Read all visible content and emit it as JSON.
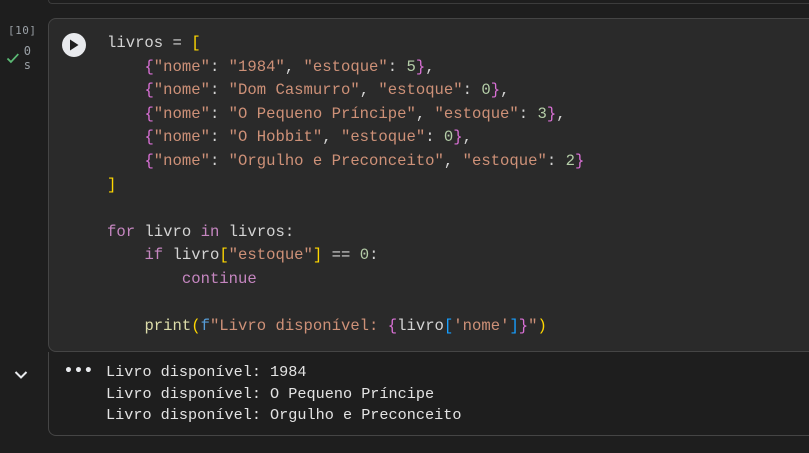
{
  "cell": {
    "execution_count": "[10]",
    "exec_time": "0 s",
    "code_lines": [
      [
        {
          "t": "livros = ",
          "c": ""
        },
        {
          "t": "[",
          "c": "br1"
        }
      ],
      [
        {
          "t": "    ",
          "c": ""
        },
        {
          "t": "{",
          "c": "br2"
        },
        {
          "t": "\"nome\"",
          "c": "str"
        },
        {
          "t": ": ",
          "c": ""
        },
        {
          "t": "\"1984\"",
          "c": "str"
        },
        {
          "t": ", ",
          "c": ""
        },
        {
          "t": "\"estoque\"",
          "c": "str"
        },
        {
          "t": ": ",
          "c": ""
        },
        {
          "t": "5",
          "c": "num"
        },
        {
          "t": "}",
          "c": "br2"
        },
        {
          "t": ",",
          "c": ""
        }
      ],
      [
        {
          "t": "    ",
          "c": ""
        },
        {
          "t": "{",
          "c": "br2"
        },
        {
          "t": "\"nome\"",
          "c": "str"
        },
        {
          "t": ": ",
          "c": ""
        },
        {
          "t": "\"Dom Casmurro\"",
          "c": "str"
        },
        {
          "t": ", ",
          "c": ""
        },
        {
          "t": "\"estoque\"",
          "c": "str"
        },
        {
          "t": ": ",
          "c": ""
        },
        {
          "t": "0",
          "c": "num"
        },
        {
          "t": "}",
          "c": "br2"
        },
        {
          "t": ",",
          "c": ""
        }
      ],
      [
        {
          "t": "    ",
          "c": ""
        },
        {
          "t": "{",
          "c": "br2"
        },
        {
          "t": "\"nome\"",
          "c": "str"
        },
        {
          "t": ": ",
          "c": ""
        },
        {
          "t": "\"O Pequeno Príncipe\"",
          "c": "str"
        },
        {
          "t": ", ",
          "c": ""
        },
        {
          "t": "\"estoque\"",
          "c": "str"
        },
        {
          "t": ": ",
          "c": ""
        },
        {
          "t": "3",
          "c": "num"
        },
        {
          "t": "}",
          "c": "br2"
        },
        {
          "t": ",",
          "c": ""
        }
      ],
      [
        {
          "t": "    ",
          "c": ""
        },
        {
          "t": "{",
          "c": "br2"
        },
        {
          "t": "\"nome\"",
          "c": "str"
        },
        {
          "t": ": ",
          "c": ""
        },
        {
          "t": "\"O Hobbit\"",
          "c": "str"
        },
        {
          "t": ", ",
          "c": ""
        },
        {
          "t": "\"estoque\"",
          "c": "str"
        },
        {
          "t": ": ",
          "c": ""
        },
        {
          "t": "0",
          "c": "num"
        },
        {
          "t": "}",
          "c": "br2"
        },
        {
          "t": ",",
          "c": ""
        }
      ],
      [
        {
          "t": "    ",
          "c": ""
        },
        {
          "t": "{",
          "c": "br2"
        },
        {
          "t": "\"nome\"",
          "c": "str"
        },
        {
          "t": ": ",
          "c": ""
        },
        {
          "t": "\"Orgulho e Preconceito\"",
          "c": "str"
        },
        {
          "t": ", ",
          "c": ""
        },
        {
          "t": "\"estoque\"",
          "c": "str"
        },
        {
          "t": ": ",
          "c": ""
        },
        {
          "t": "2",
          "c": "num"
        },
        {
          "t": "}",
          "c": "br2"
        }
      ],
      [
        {
          "t": "]",
          "c": "br1"
        }
      ],
      [
        {
          "t": "",
          "c": ""
        }
      ],
      [
        {
          "t": "for",
          "c": "kw2"
        },
        {
          "t": " livro ",
          "c": ""
        },
        {
          "t": "in",
          "c": "kw2"
        },
        {
          "t": " livros:",
          "c": ""
        }
      ],
      [
        {
          "t": "    ",
          "c": ""
        },
        {
          "t": "if",
          "c": "kw2"
        },
        {
          "t": " livro",
          "c": ""
        },
        {
          "t": "[",
          "c": "br1"
        },
        {
          "t": "\"estoque\"",
          "c": "str"
        },
        {
          "t": "]",
          "c": "br1"
        },
        {
          "t": " == ",
          "c": ""
        },
        {
          "t": "0",
          "c": "num"
        },
        {
          "t": ":",
          "c": ""
        }
      ],
      [
        {
          "t": "        ",
          "c": ""
        },
        {
          "t": "continue",
          "c": "kw2"
        }
      ],
      [
        {
          "t": "",
          "c": ""
        }
      ],
      [
        {
          "t": "    ",
          "c": ""
        },
        {
          "t": "print",
          "c": "fn"
        },
        {
          "t": "(",
          "c": "br1"
        },
        {
          "t": "f",
          "c": "kw"
        },
        {
          "t": "\"Livro disponível: ",
          "c": "fstr"
        },
        {
          "t": "{",
          "c": "br2"
        },
        {
          "t": "livro",
          "c": ""
        },
        {
          "t": "[",
          "c": "br3"
        },
        {
          "t": "'nome'",
          "c": "str"
        },
        {
          "t": "]",
          "c": "br3"
        },
        {
          "t": "}",
          "c": "br2"
        },
        {
          "t": "\"",
          "c": "fstr"
        },
        {
          "t": ")",
          "c": "br1"
        }
      ]
    ]
  },
  "output": {
    "lines": [
      "Livro disponível: 1984",
      "Livro disponível: O Pequeno Príncipe",
      "Livro disponível: Orgulho e Preconceito"
    ]
  },
  "colors": {
    "background": "#1e1e1e",
    "cell_background": "#2a2a2a",
    "success_check": "#5bb974"
  }
}
